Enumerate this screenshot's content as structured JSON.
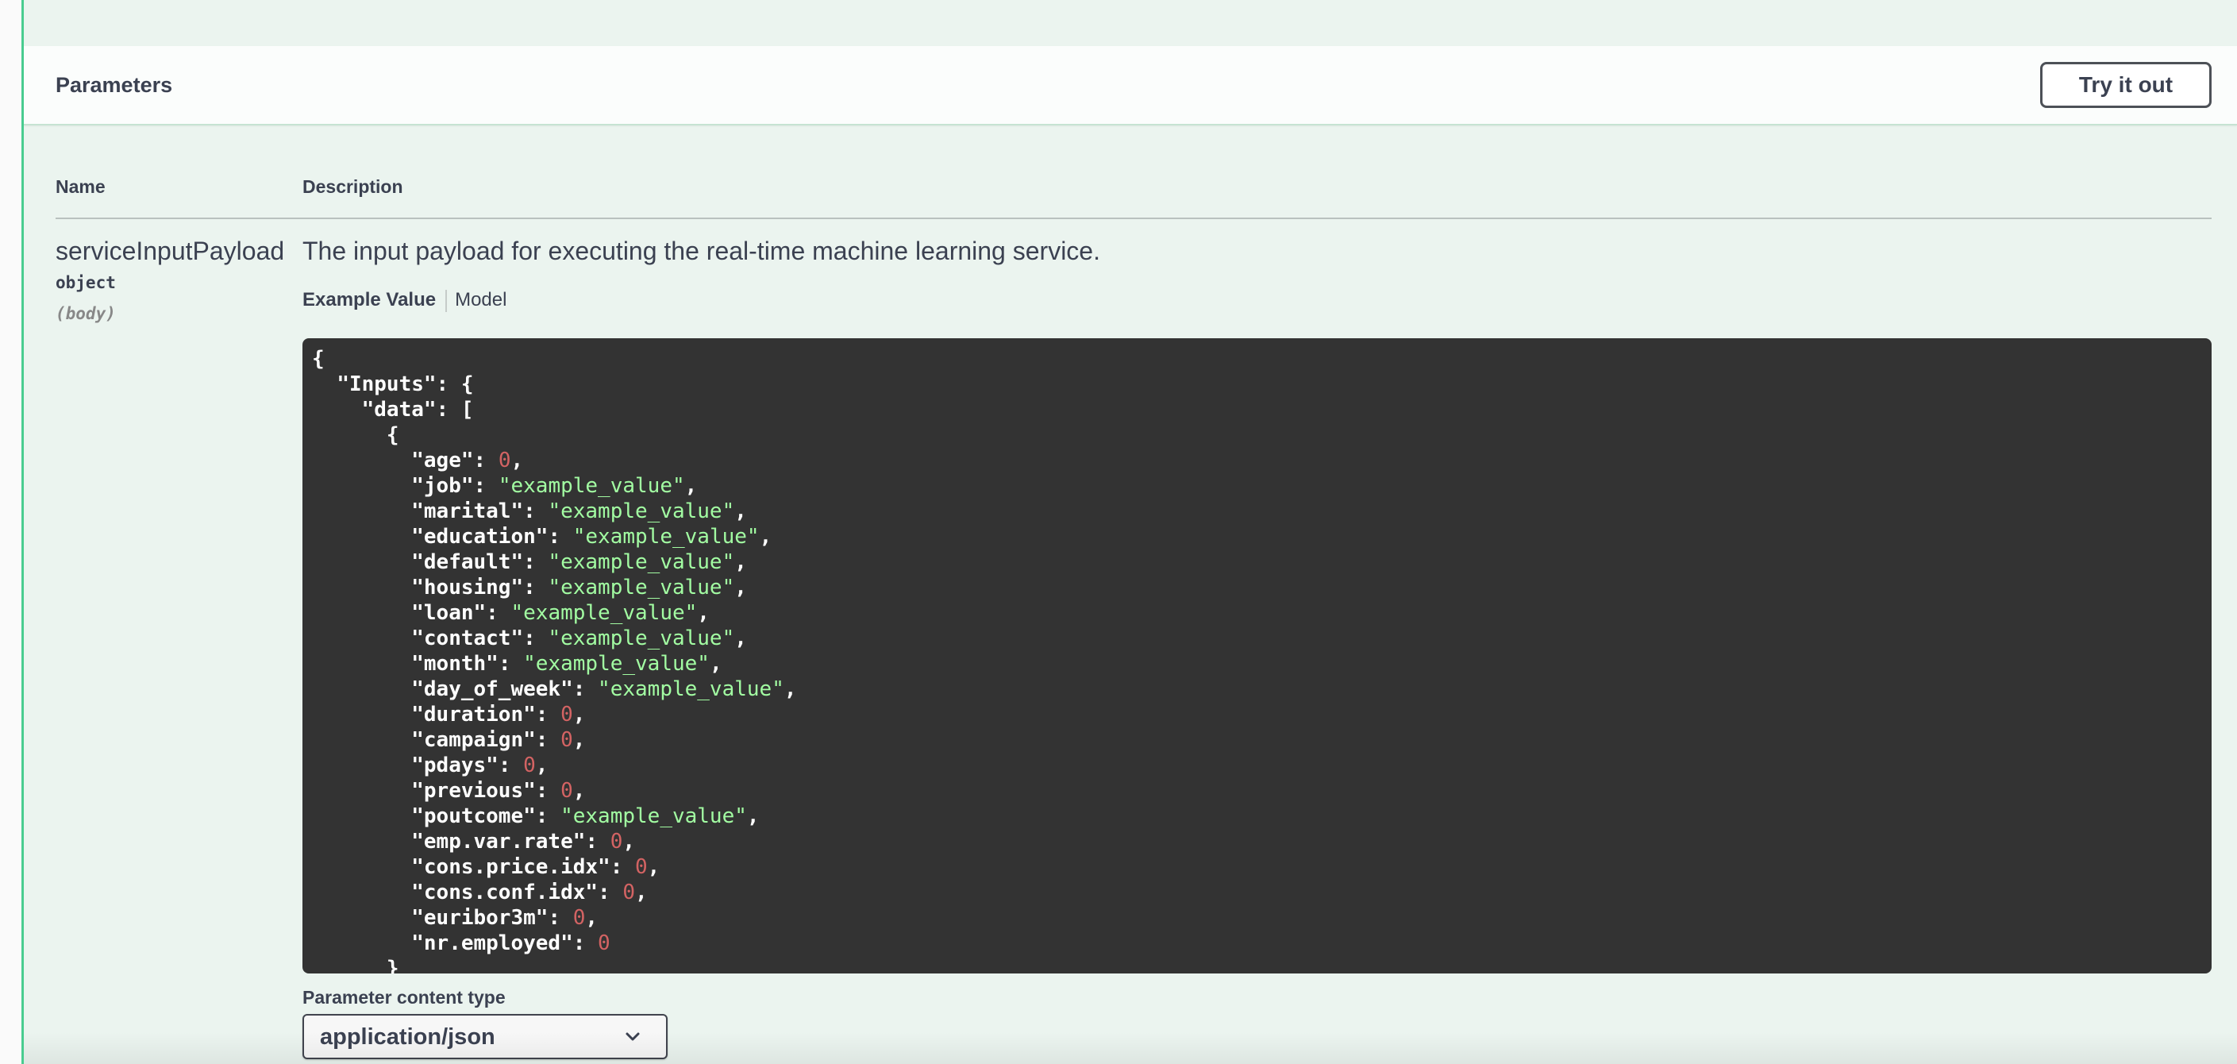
{
  "section": {
    "title": "Parameters",
    "try_button": "Try it out"
  },
  "table": {
    "col_name": "Name",
    "col_description": "Description"
  },
  "parameter": {
    "name": "serviceInputPayload",
    "type": "object",
    "in": "(body)",
    "description": "The input payload for executing the real-time machine learning service."
  },
  "tabs": {
    "example_value": "Example Value",
    "model": "Model"
  },
  "example": {
    "lines": [
      {
        "indent": 0,
        "text": "{"
      },
      {
        "indent": 1,
        "text": "\"Inputs\": {"
      },
      {
        "indent": 2,
        "text": "\"data\": ["
      },
      {
        "indent": 3,
        "text": "{"
      },
      {
        "indent": 4,
        "key": "age",
        "num": "0",
        "comma": true
      },
      {
        "indent": 4,
        "key": "job",
        "str": "example_value",
        "comma": true
      },
      {
        "indent": 4,
        "key": "marital",
        "str": "example_value",
        "comma": true
      },
      {
        "indent": 4,
        "key": "education",
        "str": "example_value",
        "comma": true
      },
      {
        "indent": 4,
        "key": "default",
        "str": "example_value",
        "comma": true
      },
      {
        "indent": 4,
        "key": "housing",
        "str": "example_value",
        "comma": true
      },
      {
        "indent": 4,
        "key": "loan",
        "str": "example_value",
        "comma": true
      },
      {
        "indent": 4,
        "key": "contact",
        "str": "example_value",
        "comma": true
      },
      {
        "indent": 4,
        "key": "month",
        "str": "example_value",
        "comma": true
      },
      {
        "indent": 4,
        "key": "day_of_week",
        "str": "example_value",
        "comma": true
      },
      {
        "indent": 4,
        "key": "duration",
        "num": "0",
        "comma": true
      },
      {
        "indent": 4,
        "key": "campaign",
        "num": "0",
        "comma": true
      },
      {
        "indent": 4,
        "key": "pdays",
        "num": "0",
        "comma": true
      },
      {
        "indent": 4,
        "key": "previous",
        "num": "0",
        "comma": true
      },
      {
        "indent": 4,
        "key": "poutcome",
        "str": "example_value",
        "comma": true
      },
      {
        "indent": 4,
        "key": "emp.var.rate",
        "num": "0",
        "comma": true
      },
      {
        "indent": 4,
        "key": "cons.price.idx",
        "num": "0",
        "comma": true
      },
      {
        "indent": 4,
        "key": "cons.conf.idx",
        "num": "0",
        "comma": true
      },
      {
        "indent": 4,
        "key": "euribor3m",
        "num": "0",
        "comma": true
      },
      {
        "indent": 4,
        "key": "nr.employed",
        "num": "0",
        "comma": false
      },
      {
        "indent": 3,
        "text": "}"
      }
    ]
  },
  "content_type": {
    "label": "Parameter content type",
    "selected": "application/json"
  },
  "icons": {
    "chevron": "chevron-down-icon"
  },
  "colors": {
    "accent": "#49cc90",
    "string": "#a2fca2",
    "number": "#d36363",
    "code_bg": "#333333"
  }
}
